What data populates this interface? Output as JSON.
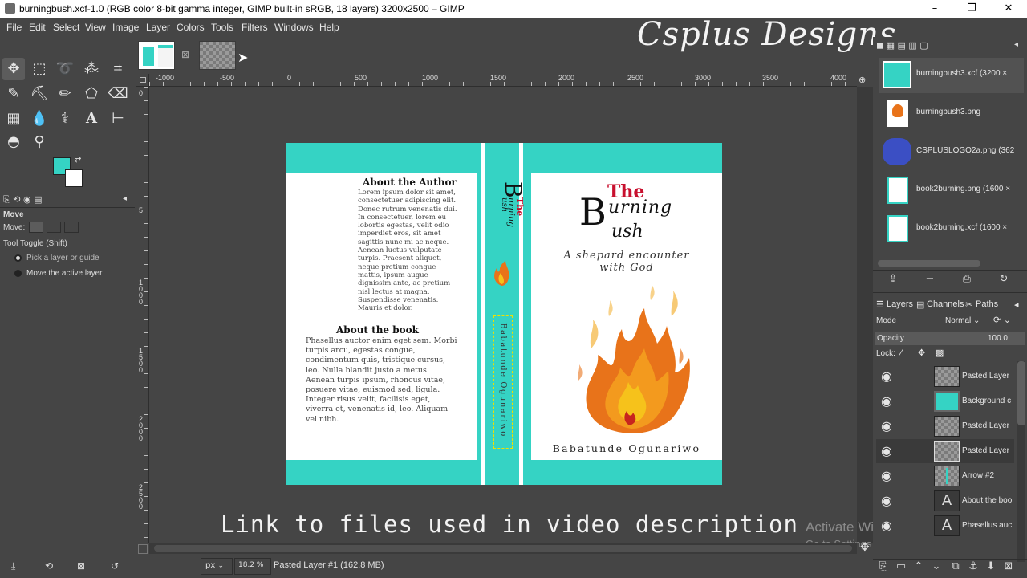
{
  "window": {
    "title": "burningbush.xcf-1.0 (RGB color 8-bit gamma integer, GIMP built-in sRGB, 18 layers) 3200x2500 – GIMP",
    "minimize": "–",
    "maximize": "❐",
    "close": "✕"
  },
  "menu": [
    "File",
    "Edit",
    "Select",
    "View",
    "Image",
    "Layer",
    "Colors",
    "Tools",
    "Filters",
    "Windows",
    "Help"
  ],
  "watermark": "Csplus Designs",
  "toolbox": {
    "fg_color": "#35d3c4",
    "bg_color": "#ffffff",
    "options_title": "Move",
    "move_label": "Move:",
    "tool_toggle": "Tool Toggle  (Shift)",
    "option_pick": "Pick a layer or guide",
    "option_move_active": "Move the active layer"
  },
  "ruler": {
    "h_labels": [
      "-1000",
      "-500",
      "0",
      "500",
      "1000",
      "1500",
      "2000",
      "2500",
      "3000",
      "3500",
      "4000"
    ],
    "v_labels": [
      "0",
      "5",
      "1000",
      "1500",
      "2000",
      "2500",
      "3000"
    ]
  },
  "cover": {
    "accent": "#35d3c4",
    "back": {
      "author_heading": "About the Author",
      "author_text": "Lorem ipsum dolor sit amet, consectetuer adipiscing elit. Donec rutrum venenatis dui. In consectetuer, lorem eu lobortis egestas, velit odio imperdiet eros, sit amet sagittis nunc mi ac neque. Aenean luctus vulputate turpis. Praesent aliquet, neque pretium congue mattis, ipsum augue dignissim ante, ac pretium nisl lectus at magna. Suspendisse venenatis. Mauris et dolor.",
      "book_heading": "About the book",
      "book_text": "Phasellus auctor enim eget sem. Morbi turpis arcu, egestas congue, condimentum quis, tristique cursus, leo. Nulla blandit justo a metus. Aenean turpis ipsum, rhoncus vitae, posuere vitae, euismod sed, ligula. Integer risus velit, facilisis eget, viverra et, venenatis id, leo. Aliquam vel nibh."
    },
    "spine": {
      "the": "The",
      "b": "B",
      "urning": "urning",
      "ush": "ush",
      "author": "Babatunde Ogunariwo"
    },
    "front": {
      "the": "The",
      "b": "B",
      "urning": "urning",
      "ush": "ush",
      "subtitle_1": "A shepard encounter",
      "subtitle_2": "with God",
      "author": "Babatunde Ogunariwo"
    }
  },
  "overlay_text": "Link to files used in video description",
  "activate": {
    "line1": "Activate Windows",
    "line2": "Go to Settings to activate Windows."
  },
  "statusbar": {
    "unit": "px",
    "zoom": "18.2 %",
    "status": "Pasted Layer #1 (162.8 MB)"
  },
  "images_panel": [
    "burningbush3.xcf (3200 ×",
    "burningbush3.png",
    "CSPLUSLOGO2a.png (362",
    "book2burning.png (1600 ×",
    "book2burning.xcf (1600 ×"
  ],
  "dock_tabs": {
    "layers": "Layers",
    "channels": "Channels",
    "paths": "Paths"
  },
  "layers_panel": {
    "mode_label": "Mode",
    "mode_value": "Normal",
    "opacity_label": "Opacity",
    "opacity_value": "100.0",
    "lock_label": "Lock:",
    "layers": [
      "Pasted Layer",
      "Background c",
      "Pasted Layer",
      "Pasted Layer",
      "Arrow #2",
      "About the boo",
      "Phasellus auc"
    ]
  }
}
